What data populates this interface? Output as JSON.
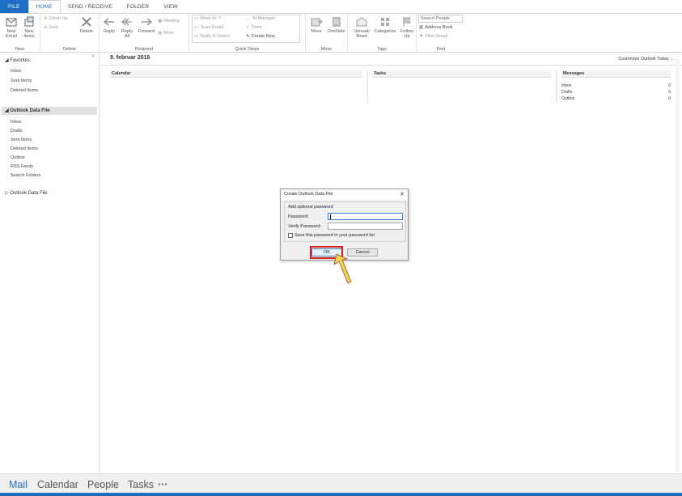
{
  "ribbon_tabs": [
    "FILE",
    "HOME",
    "SEND / RECEIVE",
    "FOLDER",
    "VIEW"
  ],
  "ribbon": {
    "new_email": "New\nEmail",
    "new_items": "New\nItems",
    "clean_up": "Clean Up",
    "junk": "Junk",
    "delete": "Delete",
    "reply": "Reply",
    "reply_all": "Reply\nAll",
    "forward": "Forward",
    "meeting": "Meeting",
    "more": "More",
    "move_to": "Move to: ?",
    "team_email": "Team Email",
    "reply_delete": "Reply & Delete",
    "to_manager": "To Manager",
    "done": "Done",
    "create_new": "Create New",
    "move": "Move",
    "onenote": "OneNote",
    "unread_read": "Unread/\nRead",
    "categorize": "Categorize",
    "follow_up": "Follow\nUp",
    "search_people": "Search People",
    "address_book": "Address Book",
    "filter_email": "Filter Email",
    "groups": {
      "new": "New",
      "delete": "Delete",
      "respond": "Respond",
      "quick_steps": "Quick Steps",
      "move": "Move",
      "tags": "Tags",
      "find": "Find"
    }
  },
  "nav": {
    "favorites": "Favorites",
    "favorites_items": [
      "Inbox",
      "Sent Items",
      "Deleted Items"
    ],
    "data_file": "Outlook Data File",
    "data_file_items": [
      "Inbox",
      "Drafts",
      "Sent Items",
      "Deleted Items",
      "Outbox",
      "RSS Feeds",
      "Search Folders"
    ],
    "data_file_2": "Outlook Data File"
  },
  "main": {
    "date": "9. februar 2016",
    "customize": "Customize Outlook Today ...",
    "calendar": "Calendar",
    "tasks": "Tasks",
    "messages": "Messages",
    "message_rows": [
      {
        "label": "Inbox",
        "count": "0"
      },
      {
        "label": "Drafts",
        "count": "0"
      },
      {
        "label": "Outbox",
        "count": "0"
      }
    ]
  },
  "dialog": {
    "title": "Create Outlook Data File",
    "subtitle": "Add optional password",
    "password_label": "Password:",
    "verify_label": "Verify Password:",
    "save_label": "Save this password in your password list",
    "ok": "OK",
    "cancel": "Cancel"
  },
  "bottom_nav": {
    "mail": "Mail",
    "calendar": "Calendar",
    "people": "People",
    "tasks": "Tasks",
    "more": "···"
  },
  "colors": {
    "accent": "#1e6fc4",
    "highlight": "#d42020",
    "arrow": "#e8d84a"
  }
}
